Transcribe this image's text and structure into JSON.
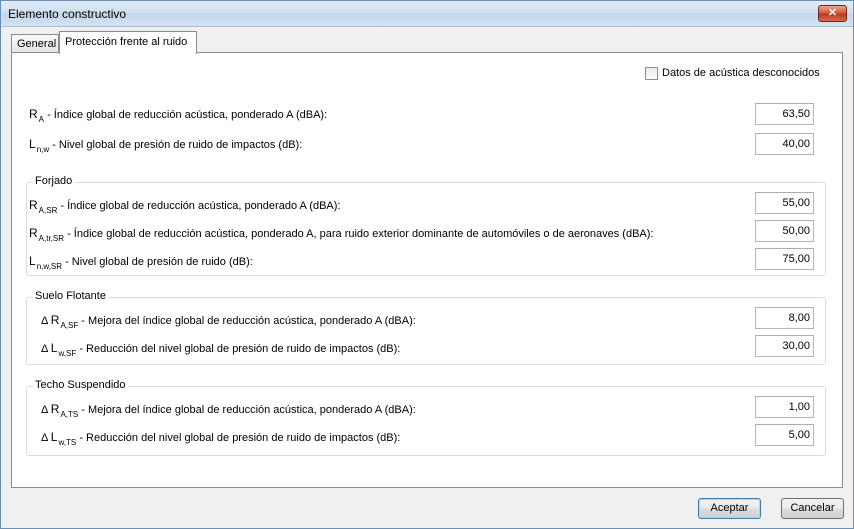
{
  "window": {
    "title": "Elemento constructivo",
    "close_label": "✕"
  },
  "tabs": [
    {
      "label": "General"
    },
    {
      "label": "Protección frente al ruido"
    }
  ],
  "checkbox": {
    "label": "Datos de acústica desconocidos",
    "checked": false
  },
  "general": {
    "ra": {
      "sym": "R",
      "sub": "A",
      "text": " - Índice global de reducción acústica, ponderado A (dBA):",
      "value": "63,50"
    },
    "lnw": {
      "sym": "L",
      "sub": "n,w",
      "text": " - Nivel global de presión de ruido de impactos (dB):",
      "value": "40,00"
    }
  },
  "forjado": {
    "title": "Forjado",
    "rows": [
      {
        "prefix": "",
        "sym": "R",
        "sub": "A,SR",
        "text": " - Índice global de reducción acústica, ponderado A (dBA):",
        "value": "55,00"
      },
      {
        "prefix": "",
        "sym": "R",
        "sub": "A,tr,SR",
        "text": " - Índice global de reducción acústica, ponderado A, para ruido exterior dominante de automóviles o de aeronaves (dBA):",
        "value": "50,00"
      },
      {
        "prefix": "",
        "sym": "L",
        "sub": "n,w,SR",
        "text": " - Nivel global de presión de ruido (dB):",
        "value": "75,00"
      }
    ]
  },
  "suelo": {
    "title": "Suelo Flotante",
    "rows": [
      {
        "prefix": "Δ ",
        "sym": "R",
        "sub": "A,SF",
        "text": " - Mejora del índice global de reducción acústica, ponderado A (dBA):",
        "value": "8,00"
      },
      {
        "prefix": "Δ ",
        "sym": "L",
        "sub": "w,SF",
        "text": " - Reducción del nivel global de presión de ruido de impactos (dB):",
        "value": "30,00"
      }
    ]
  },
  "techo": {
    "title": "Techo Suspendido",
    "rows": [
      {
        "prefix": "Δ ",
        "sym": "R",
        "sub": "A,TS",
        "text": " - Mejora del índice global de reducción acústica, ponderado A (dBA):",
        "value": "1,00"
      },
      {
        "prefix": "Δ ",
        "sym": "L",
        "sub": "w,TS",
        "text": " - Reducción del nivel global de presión de ruido de impactos (dB):",
        "value": "5,00"
      }
    ]
  },
  "buttons": {
    "accept": "Aceptar",
    "cancel": "Cancelar"
  }
}
